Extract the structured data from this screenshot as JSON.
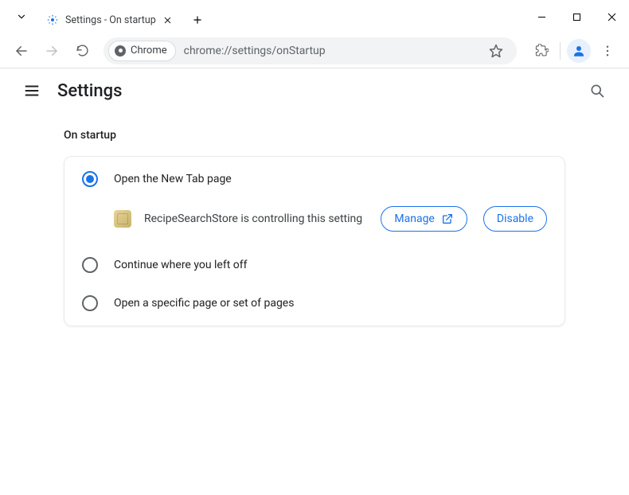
{
  "window": {
    "tab_title": "Settings - On startup"
  },
  "toolbar": {
    "chrome_pill": "Chrome",
    "url": "chrome://settings/onStartup"
  },
  "header": {
    "title": "Settings"
  },
  "section": {
    "title": "On startup",
    "options": {
      "new_tab": "Open the New Tab page",
      "continue": "Continue where you left off",
      "specific": "Open a specific page or set of pages"
    },
    "extension_notice": "RecipeSearchStore is controlling this setting",
    "manage_label": "Manage",
    "disable_label": "Disable"
  }
}
